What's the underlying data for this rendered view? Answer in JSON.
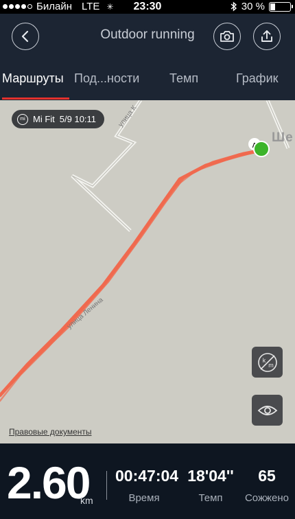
{
  "status_bar": {
    "carrier": "Билайн",
    "network": "LTE",
    "time": "23:30",
    "battery_percent_text": "30 %",
    "battery_level": 0.3
  },
  "header": {
    "title": "Outdoor running",
    "back_icon": "chevron-left-icon",
    "camera_icon": "camera-icon",
    "share_icon": "upload-icon"
  },
  "tabs": [
    {
      "label": "Маршруты",
      "active": true
    },
    {
      "label": "Под...ности",
      "active": false
    },
    {
      "label": "Темп",
      "active": false
    },
    {
      "label": "График",
      "active": false
    }
  ],
  "map": {
    "badge_brand": "Mi Fit",
    "badge_date": "5/9 10:11",
    "street_top": "улица К",
    "street_bottom": "улица Ленина",
    "place_label": "Ше",
    "legal_link": "Правовые документы",
    "unit_toggle_icon": "km-unit-toggle-icon",
    "visibility_icon": "eye-icon",
    "route_color": "#f06a4f",
    "end_marker_color": "#3cb42a"
  },
  "stats": {
    "distance_value": "2.60",
    "distance_unit": "km",
    "time_value": "00:47:04",
    "time_label": "Время",
    "pace_value": "18'04''",
    "pace_label": "Темп",
    "calories_value": "65",
    "calories_label": "Сожжено"
  }
}
